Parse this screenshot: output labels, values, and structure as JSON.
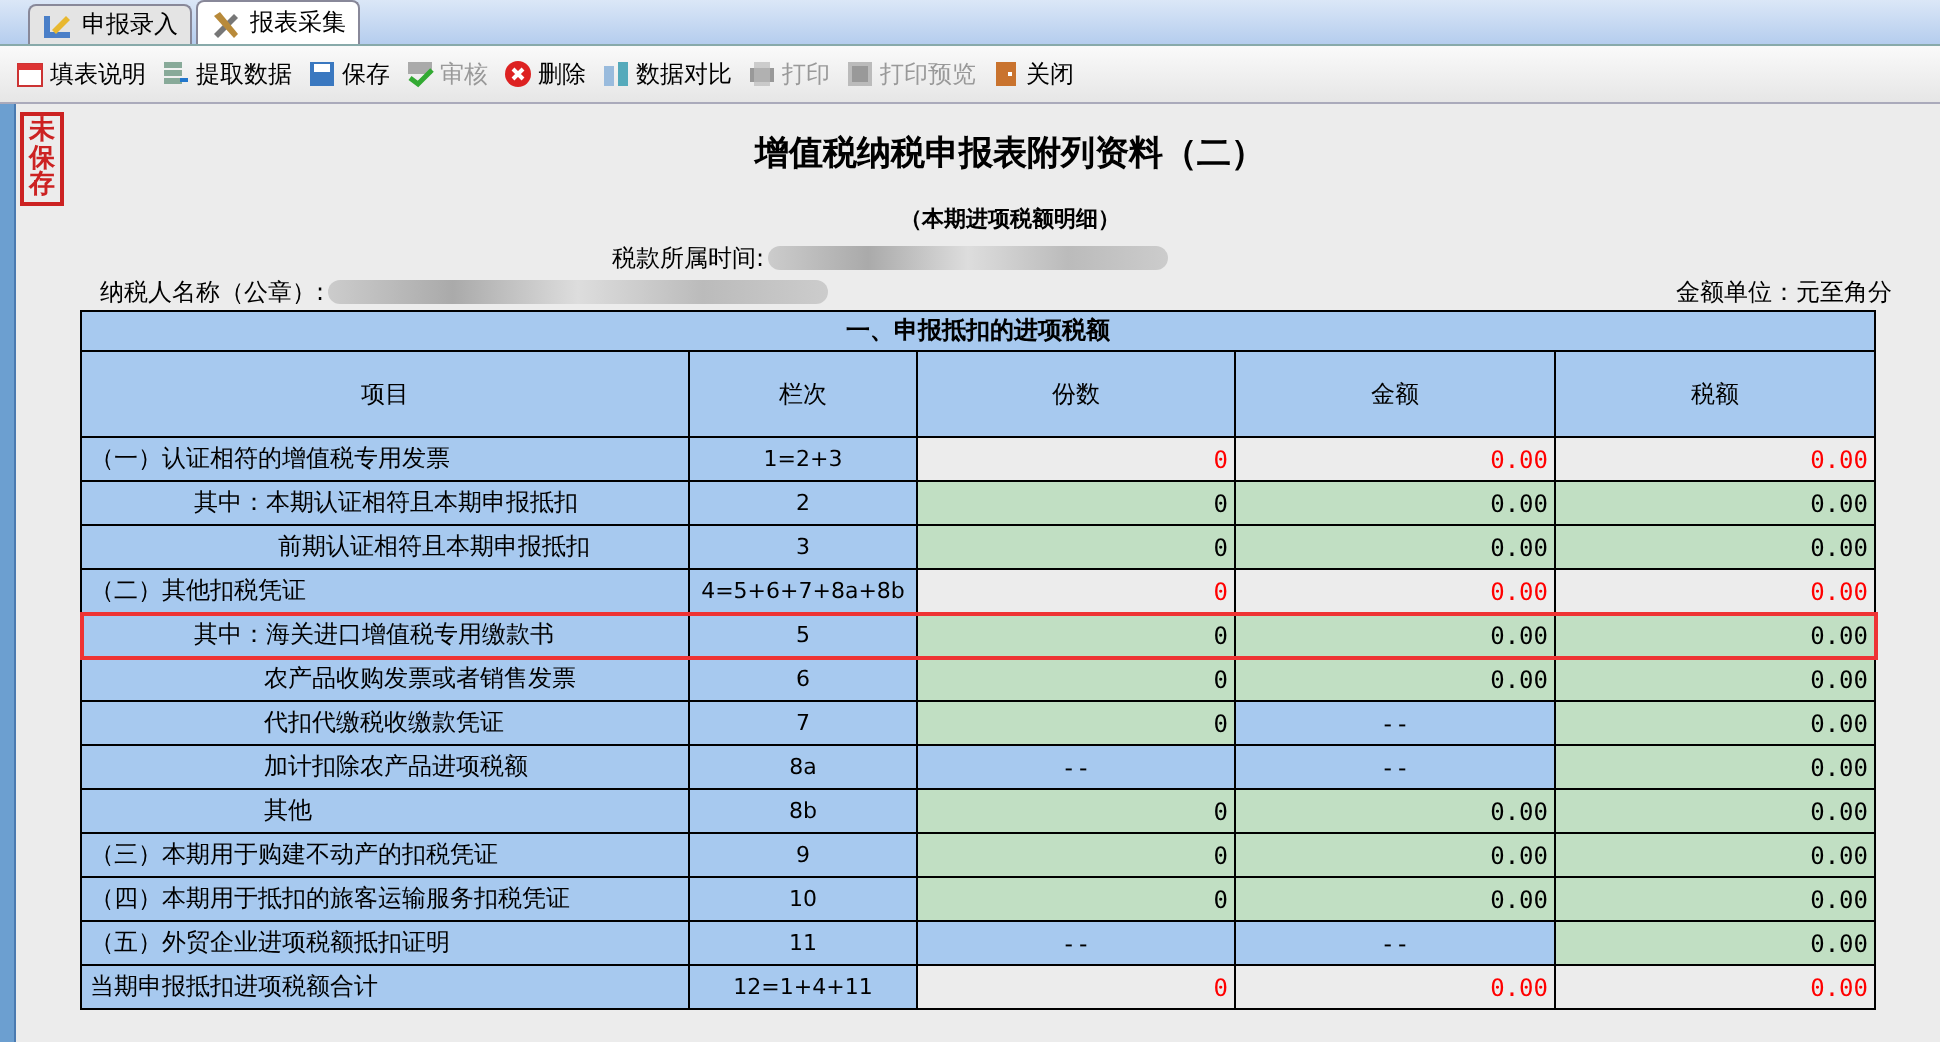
{
  "tabs": [
    {
      "label": "申报录入",
      "selected": false
    },
    {
      "label": "报表采集",
      "selected": true
    }
  ],
  "toolbar": [
    {
      "label": "填表说明",
      "kind": "calendar",
      "disabled": false
    },
    {
      "label": "提取数据",
      "kind": "database",
      "disabled": false
    },
    {
      "label": "保存",
      "kind": "save",
      "disabled": false
    },
    {
      "label": "审核",
      "kind": "check",
      "disabled": true
    },
    {
      "label": "删除",
      "kind": "delete",
      "disabled": false
    },
    {
      "label": "数据对比",
      "kind": "compare",
      "disabled": false
    },
    {
      "label": "打印",
      "kind": "print",
      "disabled": true
    },
    {
      "label": "打印预览",
      "kind": "preview",
      "disabled": true
    },
    {
      "label": "关闭",
      "kind": "door",
      "disabled": false
    }
  ],
  "stamp": "未保存",
  "title": "增值税纳税申报表附列资料（二）",
  "subtitle": "（本期进项税额明细）",
  "period_label": "税款所属时间:",
  "taxpayer_label": "纳税人名称（公章）:",
  "unit_label": "金额单位：元至角分",
  "table": {
    "section": "一、申报抵扣的进项税额",
    "columns": [
      "项目",
      "栏次",
      "份数",
      "金额",
      "税额"
    ],
    "rows": [
      {
        "kind": "section",
        "selected": false,
        "cells": [
          {
            "kind": "item",
            "value": "（一）认证相符的增值税专用发票"
          },
          {
            "kind": "line",
            "value": "1=2+3"
          },
          {
            "kind": "total",
            "value": "0"
          },
          {
            "kind": "total",
            "value": "0.00"
          },
          {
            "kind": "total",
            "value": "0.00"
          }
        ]
      },
      {
        "kind": "sub_lead",
        "selected": false,
        "cells": [
          {
            "kind": "item",
            "value": "其中：本期认证相符且本期申报抵扣"
          },
          {
            "kind": "line",
            "value": "2"
          },
          {
            "kind": "input",
            "value": "0"
          },
          {
            "kind": "input",
            "value": "0.00"
          },
          {
            "kind": "input",
            "value": "0.00"
          }
        ]
      },
      {
        "kind": "sub_after_lead",
        "selected": false,
        "cells": [
          {
            "kind": "item",
            "value": "前期认证相符且本期申报抵扣"
          },
          {
            "kind": "line",
            "value": "3"
          },
          {
            "kind": "input",
            "value": "0"
          },
          {
            "kind": "input",
            "value": "0.00"
          },
          {
            "kind": "input",
            "value": "0.00"
          }
        ]
      },
      {
        "kind": "section",
        "selected": false,
        "cells": [
          {
            "kind": "item",
            "value": "（二）其他扣税凭证"
          },
          {
            "kind": "line",
            "value": "4=5+6+7+8a+8b"
          },
          {
            "kind": "total",
            "value": "0"
          },
          {
            "kind": "total",
            "value": "0.00"
          },
          {
            "kind": "total",
            "value": "0.00"
          }
        ]
      },
      {
        "kind": "sub_lead",
        "selected": true,
        "cells": [
          {
            "kind": "item",
            "value": "其中：海关进口增值税专用缴款书"
          },
          {
            "kind": "line",
            "value": "5"
          },
          {
            "kind": "input",
            "value": "0"
          },
          {
            "kind": "input",
            "value": "0.00"
          },
          {
            "kind": "input",
            "value": "0.00"
          }
        ]
      },
      {
        "kind": "sub",
        "selected": false,
        "cells": [
          {
            "kind": "item",
            "value": "农产品收购发票或者销售发票"
          },
          {
            "kind": "line",
            "value": "6"
          },
          {
            "kind": "input",
            "value": "0"
          },
          {
            "kind": "input",
            "value": "0.00"
          },
          {
            "kind": "input",
            "value": "0.00"
          }
        ]
      },
      {
        "kind": "sub",
        "selected": false,
        "cells": [
          {
            "kind": "item",
            "value": "代扣代缴税收缴款凭证"
          },
          {
            "kind": "line",
            "value": "7"
          },
          {
            "kind": "input",
            "value": "0"
          },
          {
            "kind": "na",
            "value": "--"
          },
          {
            "kind": "input",
            "value": "0.00"
          }
        ]
      },
      {
        "kind": "sub",
        "selected": false,
        "cells": [
          {
            "kind": "item",
            "value": "加计扣除农产品进项税额"
          },
          {
            "kind": "line",
            "value": "8a"
          },
          {
            "kind": "na",
            "value": "--"
          },
          {
            "kind": "na",
            "value": "--"
          },
          {
            "kind": "input",
            "value": "0.00"
          }
        ]
      },
      {
        "kind": "sub",
        "selected": false,
        "cells": [
          {
            "kind": "item",
            "value": "其他"
          },
          {
            "kind": "line",
            "value": "8b"
          },
          {
            "kind": "input",
            "value": "0"
          },
          {
            "kind": "input",
            "value": "0.00"
          },
          {
            "kind": "input",
            "value": "0.00"
          }
        ]
      },
      {
        "kind": "section",
        "selected": false,
        "cells": [
          {
            "kind": "item",
            "value": "（三）本期用于购建不动产的扣税凭证"
          },
          {
            "kind": "line",
            "value": "9"
          },
          {
            "kind": "input",
            "value": "0"
          },
          {
            "kind": "input",
            "value": "0.00"
          },
          {
            "kind": "input",
            "value": "0.00"
          }
        ]
      },
      {
        "kind": "section",
        "selected": false,
        "cells": [
          {
            "kind": "item",
            "value": "（四）本期用于抵扣的旅客运输服务扣税凭证"
          },
          {
            "kind": "line",
            "value": "10"
          },
          {
            "kind": "input",
            "value": "0"
          },
          {
            "kind": "input",
            "value": "0.00"
          },
          {
            "kind": "input",
            "value": "0.00"
          }
        ]
      },
      {
        "kind": "section",
        "selected": false,
        "cells": [
          {
            "kind": "item",
            "value": "（五）外贸企业进项税额抵扣证明"
          },
          {
            "kind": "line",
            "value": "11"
          },
          {
            "kind": "na",
            "value": "--"
          },
          {
            "kind": "na",
            "value": "--"
          },
          {
            "kind": "input",
            "value": "0.00"
          }
        ]
      },
      {
        "kind": "total",
        "selected": false,
        "cells": [
          {
            "kind": "item",
            "value": "当期申报抵扣进项税额合计"
          },
          {
            "kind": "line",
            "value": "12=1+4+11"
          },
          {
            "kind": "total",
            "value": "0"
          },
          {
            "kind": "total",
            "value": "0.00"
          },
          {
            "kind": "total",
            "value": "0.00"
          }
        ]
      }
    ]
  }
}
